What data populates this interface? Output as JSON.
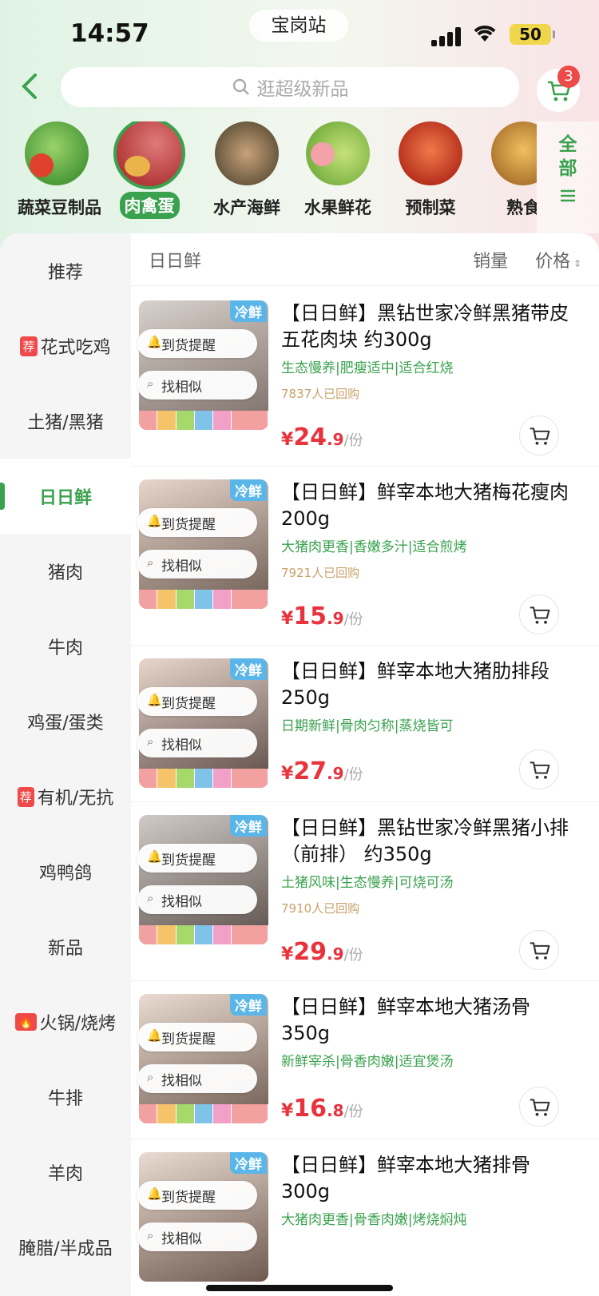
{
  "status": {
    "time": "14:57",
    "station": "宝岗站",
    "battery": "50"
  },
  "search": {
    "placeholder": "逛超级新品"
  },
  "cart": {
    "count": "3"
  },
  "categories": [
    {
      "label": "蔬菜豆制品",
      "color": "#7fc35a"
    },
    {
      "label": "肉禽蛋",
      "color": "#c95a5a",
      "active": true
    },
    {
      "label": "水产海鲜",
      "color": "#8b6a4a"
    },
    {
      "label": "水果鲜花",
      "color": "#a7d36b"
    },
    {
      "label": "预制菜",
      "color": "#e0503a"
    },
    {
      "label": "熟食",
      "color": "#d49a3a"
    }
  ],
  "all_label": {
    "line1": "全",
    "line2": "部",
    "icon": "menu-icon"
  },
  "sidebar": [
    "推荐",
    "花式吃鸡",
    "土猪/黑猪",
    "日日鲜",
    "猪肉",
    "牛肉",
    "鸡蛋/蛋类",
    "有机/无抗",
    "鸡鸭鸽",
    "新品",
    "火锅/烧烤",
    "牛排",
    "羊肉",
    "腌腊/半成品"
  ],
  "sidebar_badges": {
    "rec": "荐",
    "fire": "🔥"
  },
  "main": {
    "title": "日日鲜",
    "sort_sales": "销量",
    "sort_price": "价格"
  },
  "buttons": {
    "notify": "到货提醒",
    "similar": "找相似",
    "cold": "冷鲜"
  },
  "products": [
    {
      "name": "【日日鲜】黑钻世家冷鲜黑猪带皮五花肉块 约300g",
      "tags": "生态慢养|肥瘦适中|适合红烧",
      "sold": "7837人已回购",
      "price_int": "24",
      "price_dec": ".9",
      "unit": "/份"
    },
    {
      "name": "【日日鲜】鲜宰本地大猪梅花瘦肉 200g",
      "tags": "大猪肉更香|香嫩多汁|适合煎烤",
      "sold": "7921人已回购",
      "price_int": "15",
      "price_dec": ".9",
      "unit": "/份"
    },
    {
      "name": "【日日鲜】鲜宰本地大猪肋排段 250g",
      "tags": "日期新鲜|骨肉匀称|蒸烧皆可",
      "sold": "",
      "price_int": "27",
      "price_dec": ".9",
      "unit": "/份"
    },
    {
      "name": "【日日鲜】黑钻世家冷鲜黑猪小排（前排） 约350g",
      "tags": "土猪风味|生态慢养|可烧可汤",
      "sold": "7910人已回购",
      "price_int": "29",
      "price_dec": ".9",
      "unit": "/份"
    },
    {
      "name": "【日日鲜】鲜宰本地大猪汤骨 350g",
      "tags": "新鲜宰杀|骨香肉嫩|适宜煲汤",
      "sold": "",
      "price_int": "16",
      "price_dec": ".8",
      "unit": "/份"
    },
    {
      "name": "【日日鲜】鲜宰本地大猪排骨 300g",
      "tags": "大猪肉更香|骨香肉嫩|烤烧焖炖",
      "sold": "",
      "price_int": "",
      "price_dec": "",
      "unit": ""
    }
  ],
  "currency": "¥"
}
